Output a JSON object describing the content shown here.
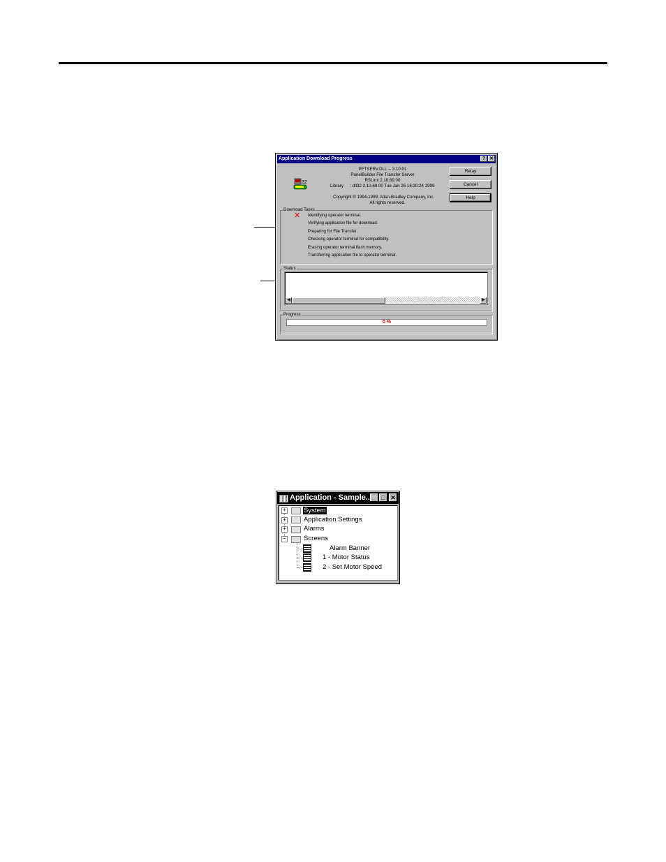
{
  "dialog": {
    "title": "Application Download Progress",
    "help_icon": "question-mark-icon",
    "close_icon": "close-icon",
    "info": {
      "product": "PFTSERV.DLL -- 3.10.01",
      "server": "PanelBuilder File Transfer Server",
      "rslinx": "RSLinx 2.10.69.00",
      "library_label": "Library",
      "library_value": ": dtl32 2.10.69.00 Tue Jan 26 16:30:24 1999",
      "copyright": "Copyright ® 1994-1999, Allen-Bradley Company, Inc.",
      "rights": "All rights reserved."
    },
    "buttons": {
      "relay": "Relay",
      "cancel": "Cancel",
      "help": "Help"
    },
    "download_tasks_label": "Download Tasks",
    "tasks": [
      "Identifying operator terminal.",
      "Verifying application file for download.",
      "Preparing for File Transfer.",
      "Checking operator terminal for compatibility.",
      "Erasing operator terminal flash memory.",
      "Transferring application file to operator terminal."
    ],
    "current_task_mark": "✕",
    "status_label": "Status",
    "progress_label": "Progress",
    "progress_text": "0 %",
    "progress_value": 0
  },
  "app_window": {
    "title": "Application - Sample...",
    "minimize": "_",
    "maximize": "□",
    "close": "✕",
    "tree": [
      {
        "label": "System",
        "expander": "+",
        "selected": true
      },
      {
        "label": "Application Settings",
        "expander": "+"
      },
      {
        "label": "Alarms",
        "expander": "+"
      },
      {
        "label": "Screens",
        "expander": "−"
      }
    ],
    "screens": [
      "Alarm Banner",
      "1 - Motor Status",
      "2 - Set Motor Speed"
    ]
  }
}
